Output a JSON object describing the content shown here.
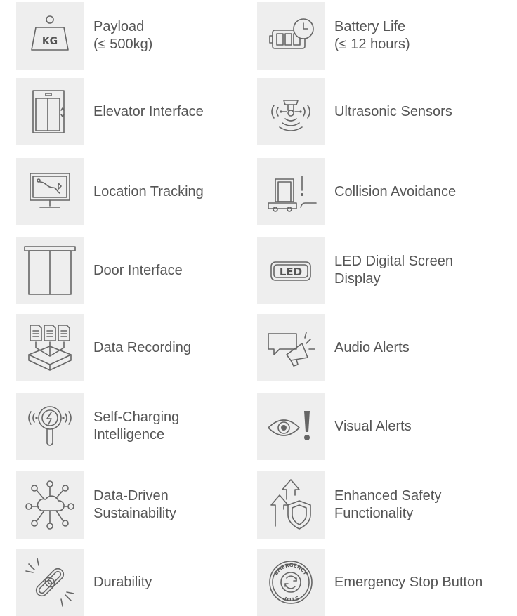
{
  "features": {
    "left": [
      {
        "icon": "payload-weight-icon",
        "lines": [
          "Payload",
          "(≤ 500kg)"
        ]
      },
      {
        "icon": "elevator-icon",
        "lines": [
          "Elevator Interface"
        ]
      },
      {
        "icon": "location-monitor-icon",
        "lines": [
          "Location Tracking"
        ]
      },
      {
        "icon": "door-icon",
        "lines": [
          "Door Interface"
        ]
      },
      {
        "icon": "data-recording-icon",
        "lines": [
          "Data Recording"
        ]
      },
      {
        "icon": "self-charging-icon",
        "lines": [
          "Self-Charging",
          "Intelligence"
        ]
      },
      {
        "icon": "cloud-network-icon",
        "lines": [
          "Data-Driven",
          "Sustainability"
        ]
      },
      {
        "icon": "chain-link-icon",
        "lines": [
          "Durability"
        ]
      }
    ],
    "right": [
      {
        "icon": "battery-clock-icon",
        "lines": [
          "Battery Life",
          "(≤ 12 hours)"
        ]
      },
      {
        "icon": "ultrasonic-sensor-icon",
        "lines": [
          "Ultrasonic Sensors"
        ]
      },
      {
        "icon": "collision-avoidance-icon",
        "lines": [
          "Collision Avoidance"
        ]
      },
      {
        "icon": "led-screen-icon",
        "lines": [
          "LED Digital Screen",
          "Display"
        ]
      },
      {
        "icon": "megaphone-chat-icon",
        "lines": [
          "Audio Alerts"
        ]
      },
      {
        "icon": "eye-alert-icon",
        "lines": [
          "Visual Alerts"
        ]
      },
      {
        "icon": "arrow-shield-icon",
        "lines": [
          "Enhanced Safety",
          "Functionality"
        ]
      },
      {
        "icon": "emergency-stop-icon",
        "lines": [
          "Emergency Stop Button"
        ]
      }
    ]
  },
  "icon_text": {
    "kg": "KG",
    "led": "LED",
    "emergency_top": "EMERGENCY",
    "emergency_bottom": "STOP"
  },
  "colors": {
    "tile": "#eeeeee",
    "icon": "#666666",
    "text": "#555555"
  }
}
